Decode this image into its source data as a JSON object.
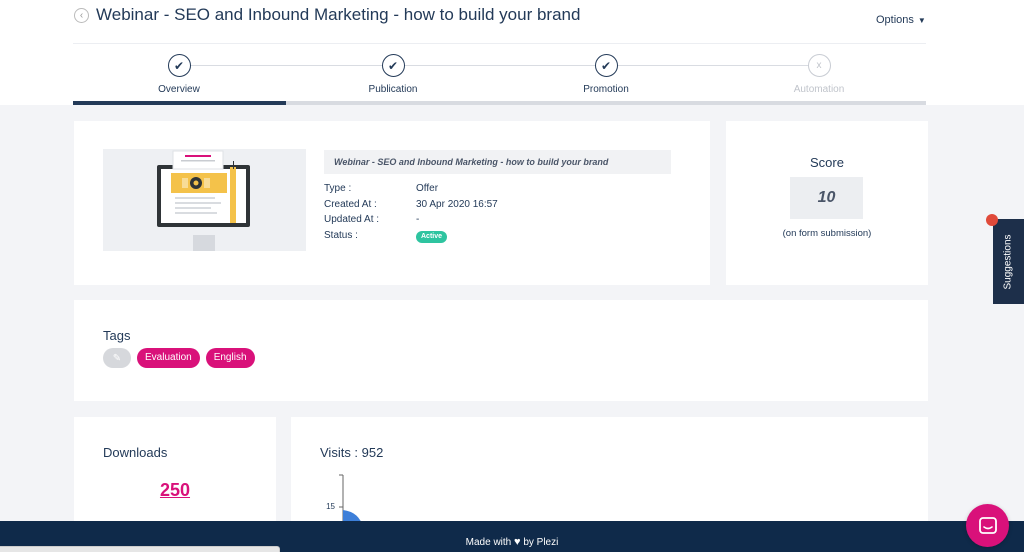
{
  "header": {
    "title": "Webinar - SEO and Inbound Marketing - how to build your brand",
    "options_label": "Options"
  },
  "stepper": {
    "steps": [
      {
        "label": "Overview",
        "state": "done"
      },
      {
        "label": "Publication",
        "state": "done"
      },
      {
        "label": "Promotion",
        "state": "done"
      },
      {
        "label": "Automation",
        "state": "disabled"
      }
    ],
    "done_symbol": "✔",
    "disabled_symbol": "x",
    "progress_fraction": 0.25
  },
  "offer": {
    "title": "Webinar - SEO and Inbound Marketing - how to build your brand",
    "meta": [
      {
        "key": "Type :",
        "value": "Offer"
      },
      {
        "key": "Created At :",
        "value": "30 Apr 2020 16:57"
      },
      {
        "key": "Updated At :",
        "value": "-"
      },
      {
        "key": "Status :",
        "value": "Active"
      }
    ]
  },
  "score": {
    "title": "Score",
    "value": "10",
    "note": "(on form submission)"
  },
  "tags": {
    "title": "Tags",
    "items": [
      "Evaluation",
      "English"
    ]
  },
  "downloads": {
    "title": "Downloads",
    "value": "250"
  },
  "visits": {
    "title": "Visits : 952",
    "tick_label": "15"
  },
  "suggestions": {
    "label": "Suggestions"
  },
  "footer": {
    "made_with": "Made with",
    "by": "by Plezi"
  },
  "colors": {
    "primary": "#233a58",
    "accent": "#d9117a",
    "active_badge": "#2ec4a0",
    "footer_bg": "#0f2a4a",
    "chart_blue": "#3d7fd9"
  },
  "icons": {
    "back": "back-arrow-icon",
    "chat": "chat-icon",
    "edit": "edit-pencil-icon",
    "heart": "heart-icon"
  }
}
